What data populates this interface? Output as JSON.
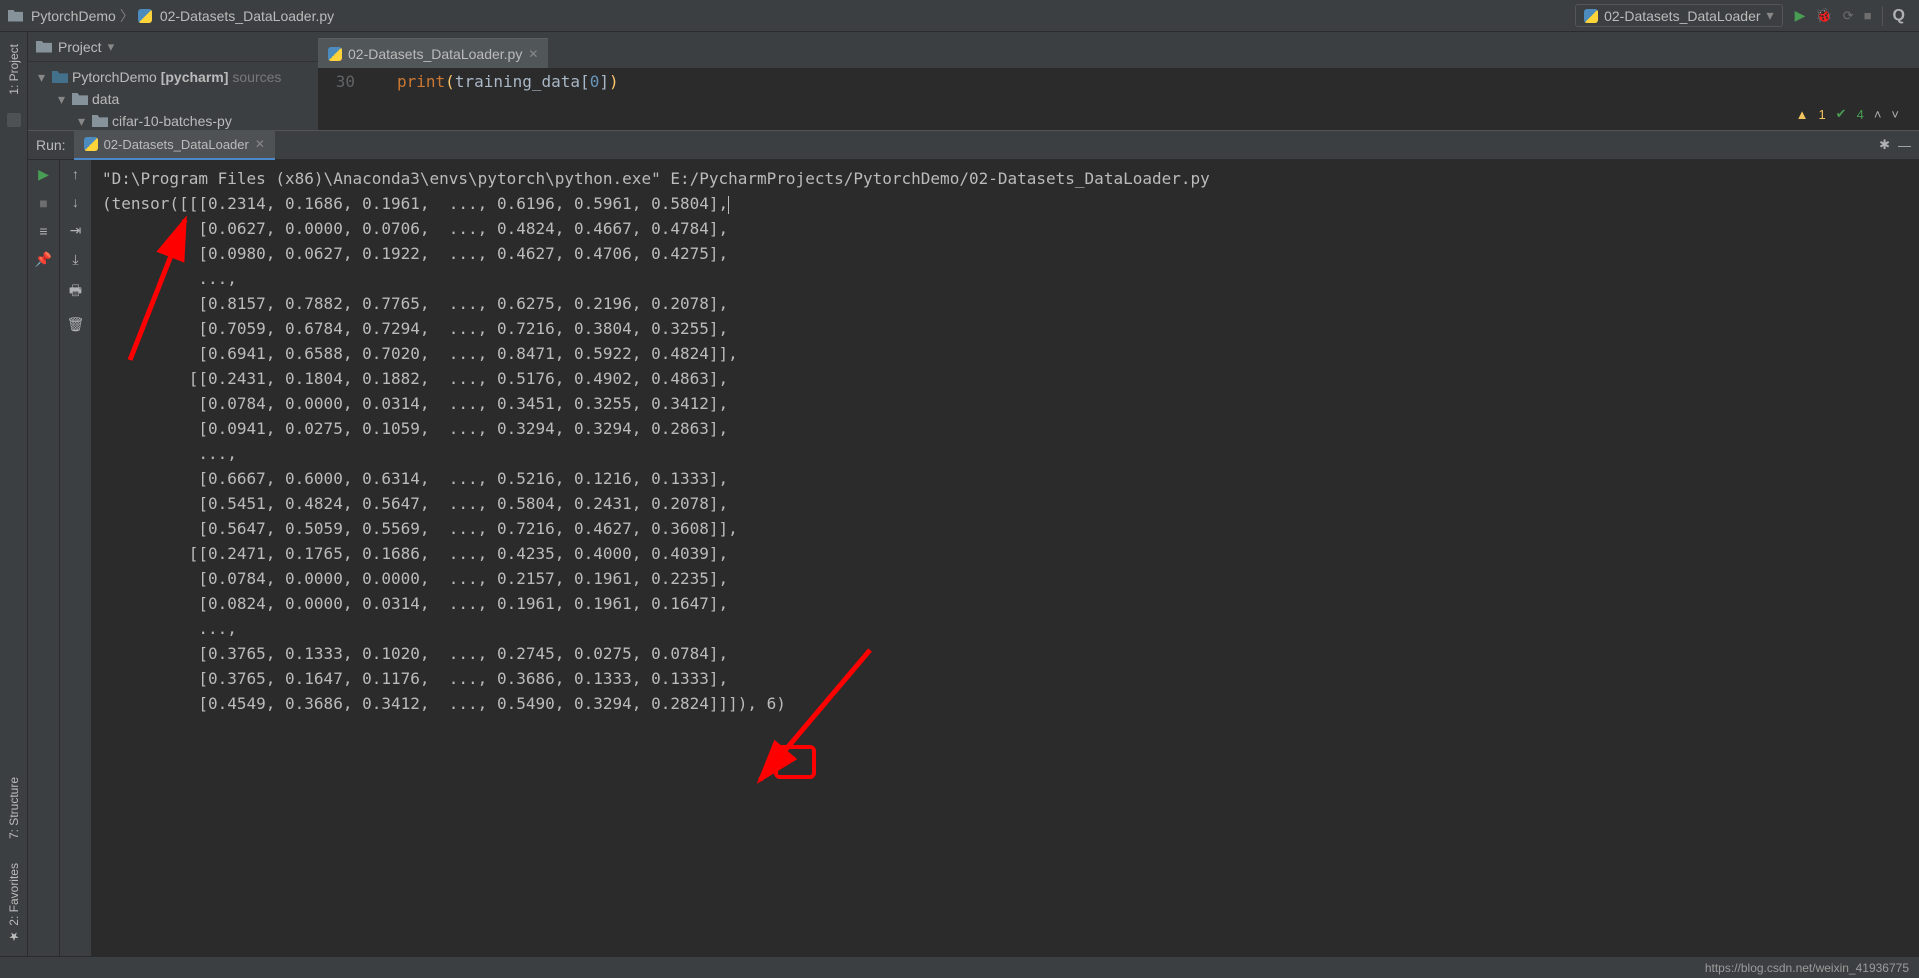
{
  "breadcrumb": {
    "root": "PytorchDemo",
    "file": "02-Datasets_DataLoader.py"
  },
  "run_config": {
    "label": "02-Datasets_DataLoader"
  },
  "project_panel_title": "Project",
  "tree": {
    "root_name": "PytorchDemo",
    "root_hint_bold": "[pycharm]",
    "root_hint_tail": "sources",
    "child1": "data",
    "child2": "cifar-10-batches-py"
  },
  "editor": {
    "tab_name": "02-Datasets_DataLoader.py",
    "line_number": "30",
    "code": {
      "kw": "print",
      "open": "(",
      "ident": "training_data",
      "bracket_open": "[",
      "index": "0",
      "bracket_close": "]",
      "close": ")"
    }
  },
  "inspections": {
    "warn_count": "1",
    "ok_count": "4"
  },
  "run_header": {
    "label": "Run:",
    "tab_name": "02-Datasets_DataLoader"
  },
  "console_lines": [
    "\"D:\\Program Files (x86)\\Anaconda3\\envs\\pytorch\\python.exe\" E:/PycharmProjects/PytorchDemo/02-Datasets_DataLoader.py",
    "(tensor([[[0.2314, 0.1686, 0.1961,  ..., 0.6196, 0.5961, 0.5804],",
    "          [0.0627, 0.0000, 0.0706,  ..., 0.4824, 0.4667, 0.4784],",
    "          [0.0980, 0.0627, 0.1922,  ..., 0.4627, 0.4706, 0.4275],",
    "          ...,",
    "          [0.8157, 0.7882, 0.7765,  ..., 0.6275, 0.2196, 0.2078],",
    "          [0.7059, 0.6784, 0.7294,  ..., 0.7216, 0.3804, 0.3255],",
    "          [0.6941, 0.6588, 0.7020,  ..., 0.8471, 0.5922, 0.4824]],",
    "",
    "         [[0.2431, 0.1804, 0.1882,  ..., 0.5176, 0.4902, 0.4863],",
    "          [0.0784, 0.0000, 0.0314,  ..., 0.3451, 0.3255, 0.3412],",
    "          [0.0941, 0.0275, 0.1059,  ..., 0.3294, 0.3294, 0.2863],",
    "          ...,",
    "          [0.6667, 0.6000, 0.6314,  ..., 0.5216, 0.1216, 0.1333],",
    "          [0.5451, 0.4824, 0.5647,  ..., 0.5804, 0.2431, 0.2078],",
    "          [0.5647, 0.5059, 0.5569,  ..., 0.7216, 0.4627, 0.3608]],",
    "",
    "         [[0.2471, 0.1765, 0.1686,  ..., 0.4235, 0.4000, 0.4039],",
    "          [0.0784, 0.0000, 0.0000,  ..., 0.2157, 0.1961, 0.2235],",
    "          [0.0824, 0.0000, 0.0314,  ..., 0.1961, 0.1961, 0.1647],",
    "          ...,",
    "          [0.3765, 0.1333, 0.1020,  ..., 0.2745, 0.0275, 0.0784],",
    "          [0.3765, 0.1647, 0.1176,  ..., 0.3686, 0.1333, 0.1333],",
    "          [0.4549, 0.3686, 0.3412,  ..., 0.5490, 0.3294, 0.2824]]]), 6)"
  ],
  "left_tabs": {
    "project": "1: Project",
    "structure": "7: Structure",
    "favorites": "2: Favorites"
  },
  "status": {
    "url": "https://blog.csdn.net/weixin_41936775"
  }
}
